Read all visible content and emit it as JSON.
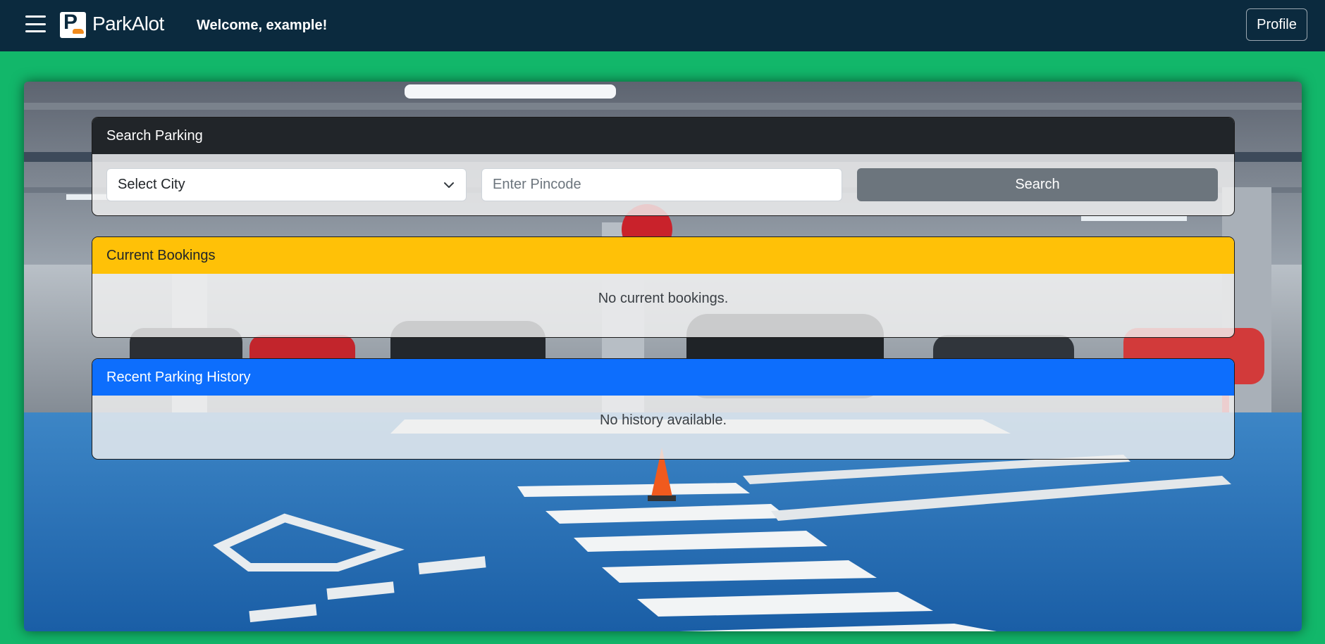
{
  "navbar": {
    "brand": "ParkAlot",
    "logo_letter": "P",
    "welcome": "Welcome, example!",
    "profile_label": "Profile"
  },
  "search_card": {
    "title": "Search Parking",
    "city_select_value": "Select City",
    "pincode_placeholder": "Enter Pincode",
    "search_label": "Search"
  },
  "current_bookings": {
    "title": "Current Bookings",
    "empty_text": "No current bookings."
  },
  "history": {
    "title": "Recent Parking History",
    "empty_text": "No history available."
  },
  "colors": {
    "page_bg": "#12b76a",
    "navbar_bg": "#0b2a3e",
    "search_header": "#212529",
    "current_header": "#ffc107",
    "history_header": "#0d6efd",
    "search_button": "#6c757d",
    "logo_car": "#f08a1c"
  },
  "icons": {
    "menu": "hamburger-menu-icon",
    "logo": "parking-p-car-logo",
    "dropdown": "chevron-down-icon"
  }
}
